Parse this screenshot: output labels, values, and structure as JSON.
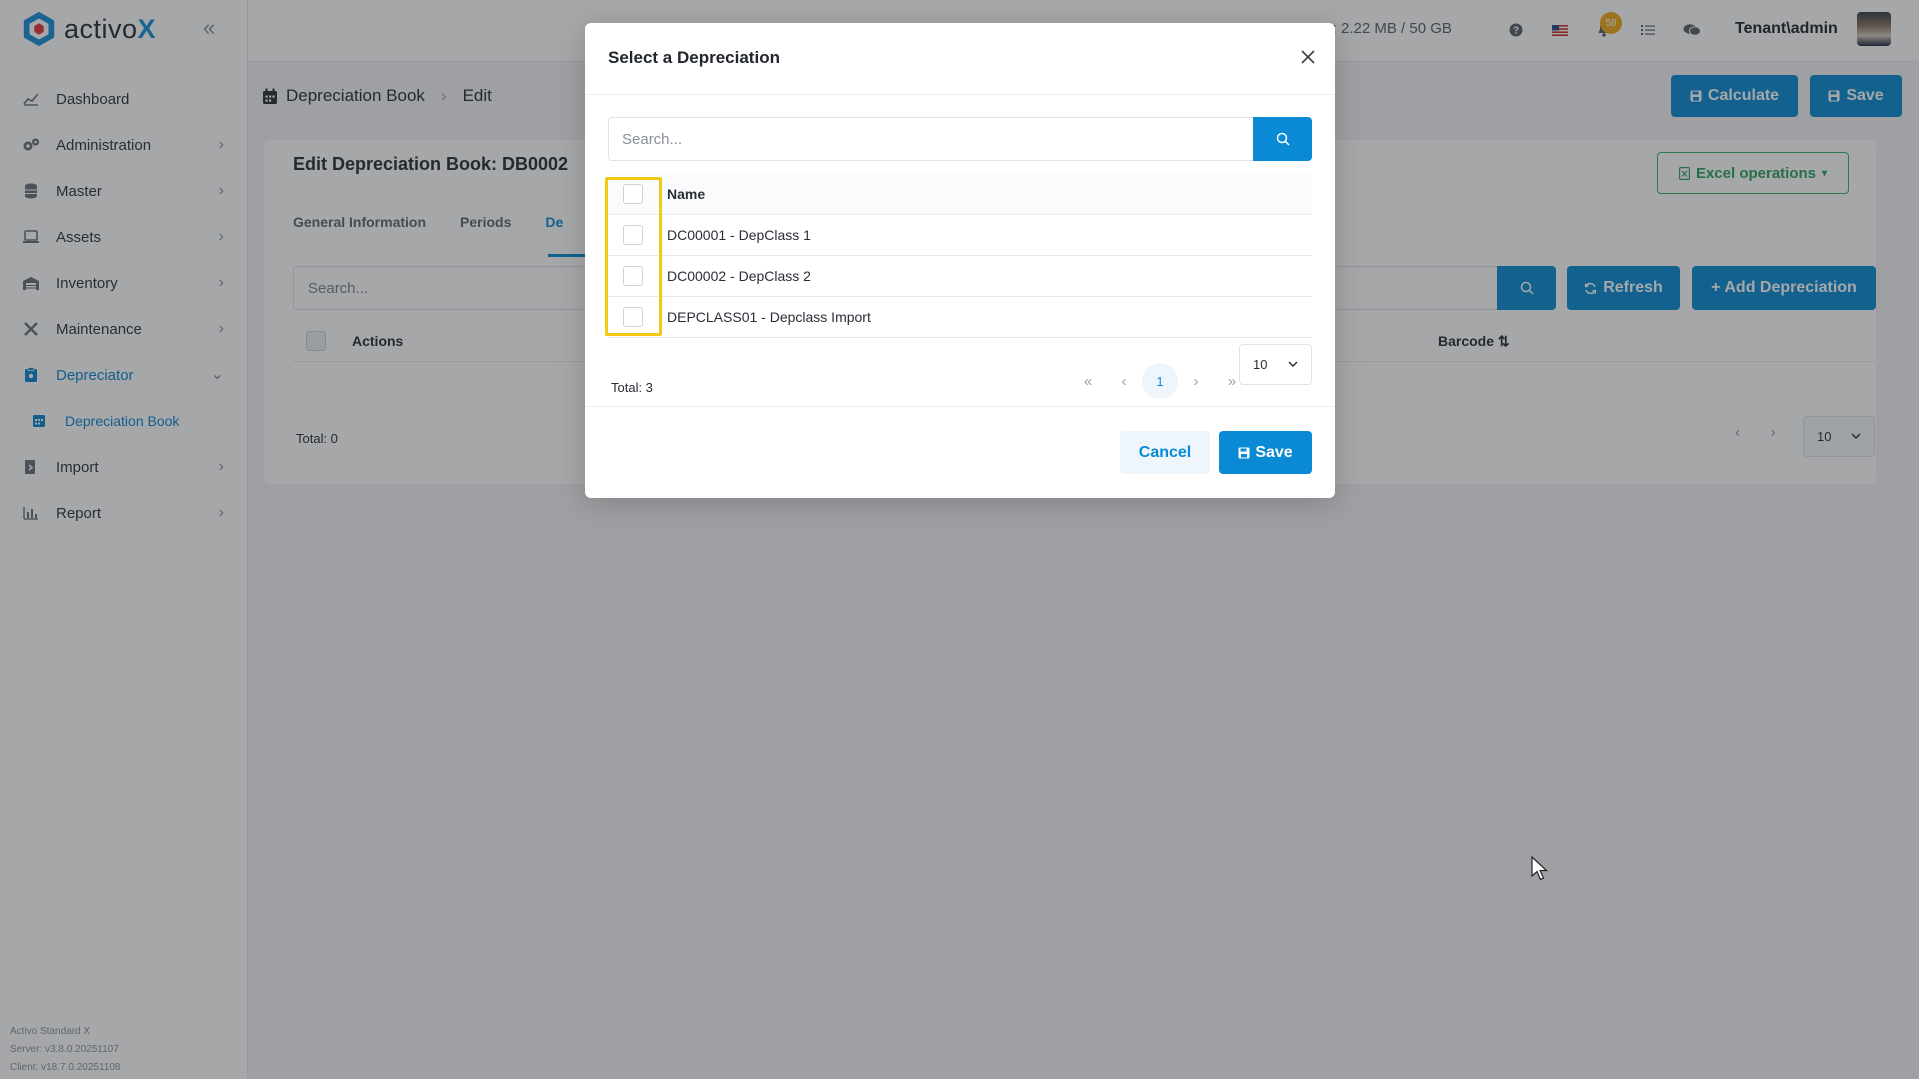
{
  "app": {
    "name_prefix": "activo",
    "name_suffix": "X"
  },
  "sidebar": {
    "items": [
      {
        "label": "Dashboard",
        "icon": "chart-line-icon"
      },
      {
        "label": "Administration",
        "icon": "cogs-icon"
      },
      {
        "label": "Master",
        "icon": "database-icon"
      },
      {
        "label": "Assets",
        "icon": "laptop-icon"
      },
      {
        "label": "Inventory",
        "icon": "warehouse-icon"
      },
      {
        "label": "Maintenance",
        "icon": "tools-icon"
      },
      {
        "label": "Depreciator",
        "icon": "clipboard-icon"
      },
      {
        "label": "Import",
        "icon": "import-icon"
      },
      {
        "label": "Report",
        "icon": "report-chart-icon"
      }
    ],
    "sub_item": "Depreciation Book",
    "footer": [
      "Activo Standard X",
      "Server: v3.8.0.20251107",
      "Client: v18.7.0.20251108"
    ]
  },
  "topbar": {
    "usage": "ge: 2.22 MB / 50 GB",
    "notification_count": "58",
    "user": "Tenant\\admin"
  },
  "page": {
    "breadcrumb": [
      "Depreciation Book",
      "Edit"
    ],
    "calculate_label": "Calculate",
    "save_label": "Save",
    "card_title": "Edit Depreciation Book: DB0002",
    "excel_label": "Excel operations",
    "tabs": [
      "General Information",
      "Periods",
      "De"
    ],
    "search_placeholder": "Search...",
    "refresh_label": "Refresh",
    "add_label": "+ Add Depreciation",
    "col_actions": "Actions",
    "col_barcode": "Barcode",
    "total": "Total: 0",
    "page_size": "10"
  },
  "modal": {
    "title": "Select a Depreciation",
    "search_placeholder": "Search...",
    "column": "Name",
    "rows": [
      "DC00001 - DepClass 1",
      "DC00002 - DepClass 2",
      "DEPCLASS01 - Depclass Import"
    ],
    "total": "Total: 3",
    "current_page": "1",
    "page_size": "10",
    "cancel_label": "Cancel",
    "save_label": "Save"
  },
  "colors": {
    "primary": "#0a8ad4",
    "highlight": "#f2c913",
    "excel": "#37b26b",
    "badge": "#f0a81a"
  }
}
